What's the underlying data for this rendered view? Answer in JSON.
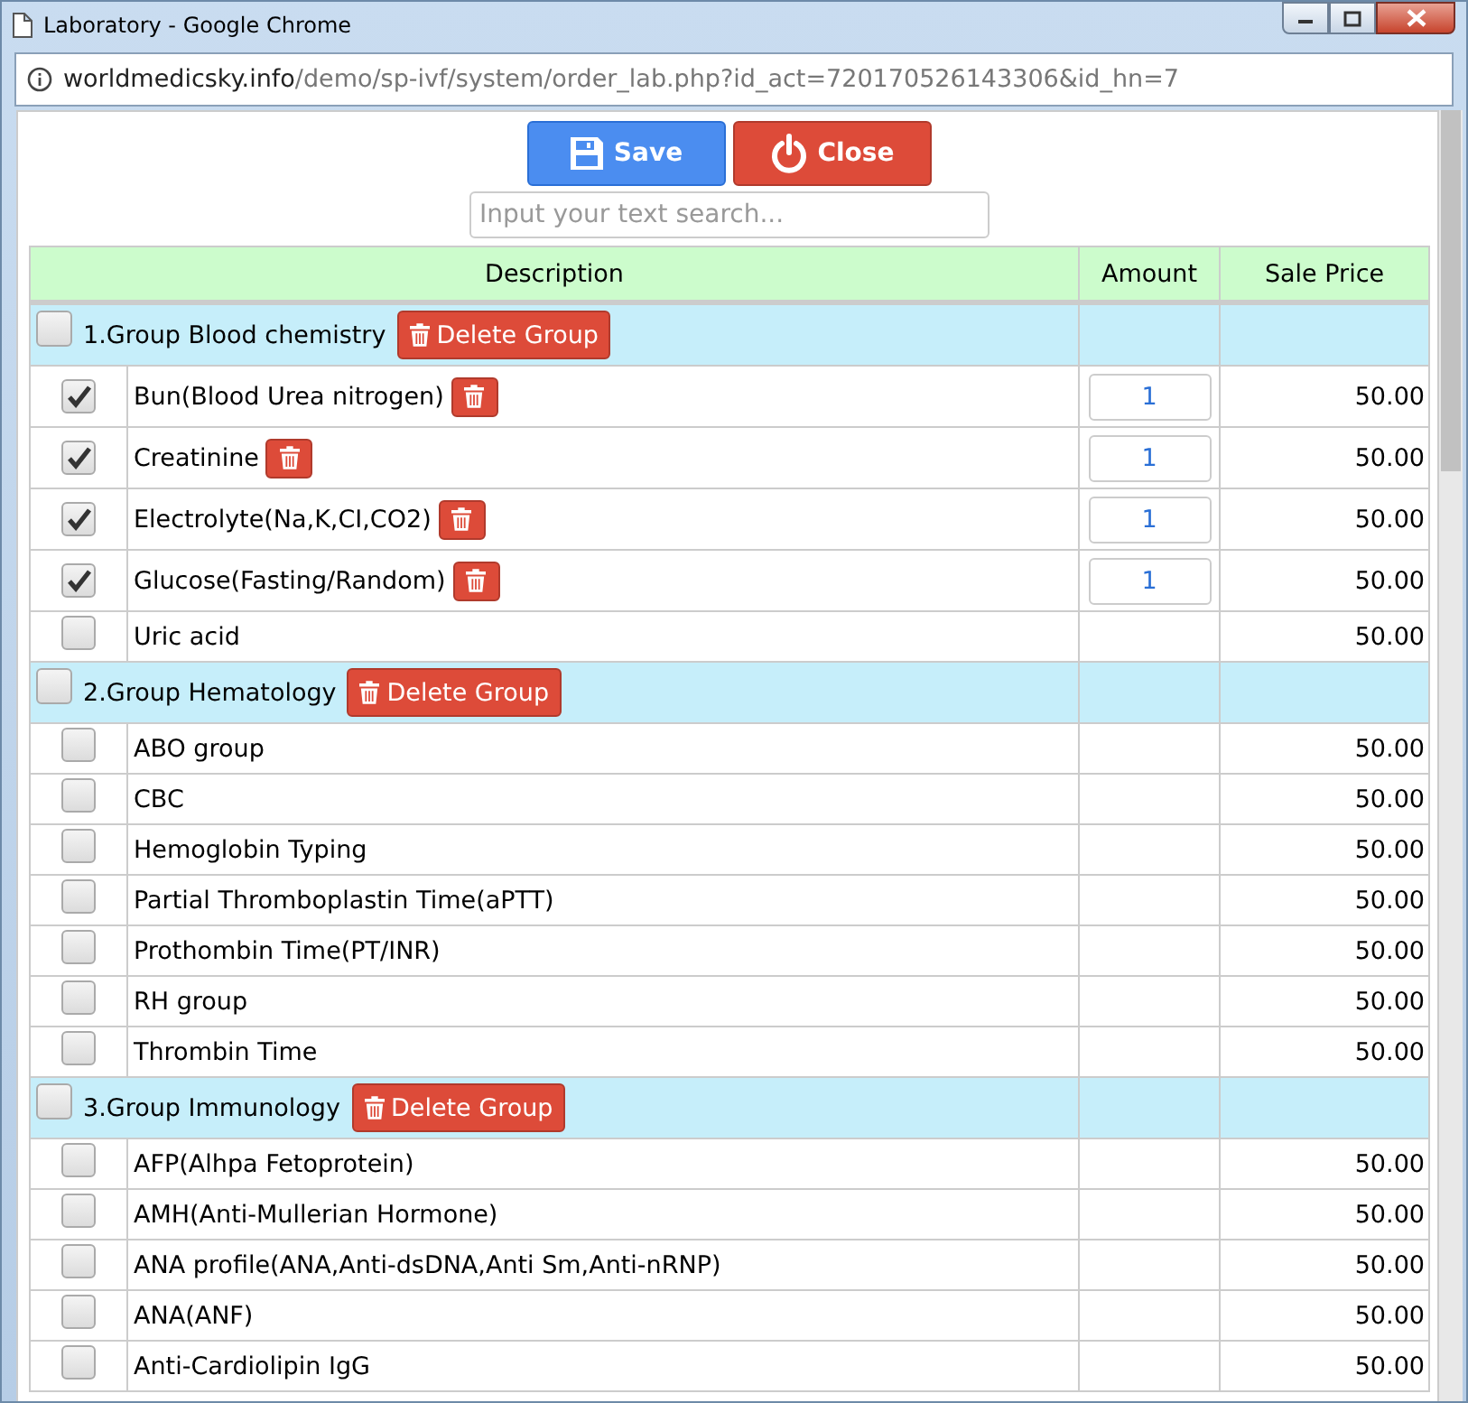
{
  "window": {
    "title": "Laboratory - Google Chrome"
  },
  "address_bar": {
    "domain": "worldmedicsky.info",
    "path": "/demo/sp-ivf/system/order_lab.php?id_act=720170526143306&id_hn=7"
  },
  "toolbar": {
    "save_label": "Save",
    "close_label": "Close"
  },
  "search": {
    "placeholder": "Input your text search..."
  },
  "table": {
    "columns": [
      "Description",
      "Amount",
      "Sale Price"
    ],
    "groups": [
      {
        "title": "1.Group Blood chemistry",
        "checked": false,
        "delete_label": "Delete Group",
        "items": [
          {
            "name": "Bun(Blood Urea nitrogen)",
            "checked": true,
            "amount": "1",
            "price": "50.00"
          },
          {
            "name": "Creatinine",
            "checked": true,
            "amount": "1",
            "price": "50.00"
          },
          {
            "name": "Electrolyte(Na,K,CI,CO2)",
            "checked": true,
            "amount": "1",
            "price": "50.00"
          },
          {
            "name": "Glucose(Fasting/Random)",
            "checked": true,
            "amount": "1",
            "price": "50.00"
          },
          {
            "name": "Uric acid",
            "checked": false,
            "price": "50.00"
          }
        ]
      },
      {
        "title": "2.Group Hematology",
        "checked": false,
        "delete_label": "Delete Group",
        "items": [
          {
            "name": "ABO group",
            "checked": false,
            "price": "50.00"
          },
          {
            "name": "CBC",
            "checked": false,
            "price": "50.00"
          },
          {
            "name": "Hemoglobin Typing",
            "checked": false,
            "price": "50.00"
          },
          {
            "name": "Partial Thromboplastin Time(aPTT)",
            "checked": false,
            "price": "50.00"
          },
          {
            "name": "Prothombin Time(PT/INR)",
            "checked": false,
            "price": "50.00"
          },
          {
            "name": "RH group",
            "checked": false,
            "price": "50.00"
          },
          {
            "name": "Thrombin Time",
            "checked": false,
            "price": "50.00"
          }
        ]
      },
      {
        "title": "3.Group Immunology",
        "checked": false,
        "delete_label": "Delete Group",
        "items": [
          {
            "name": "AFP(Alhpa Fetoprotein)",
            "checked": false,
            "price": "50.00"
          },
          {
            "name": "AMH(Anti-Mullerian Hormone)",
            "checked": false,
            "price": "50.00"
          },
          {
            "name": "ANA profile(ANA,Anti-dsDNA,Anti Sm,Anti-nRNP)",
            "checked": false,
            "price": "50.00"
          },
          {
            "name": "ANA(ANF)",
            "checked": false,
            "price": "50.00"
          },
          {
            "name": "Anti-Cardiolipin IgG",
            "checked": false,
            "price": "50.00"
          }
        ]
      }
    ]
  }
}
